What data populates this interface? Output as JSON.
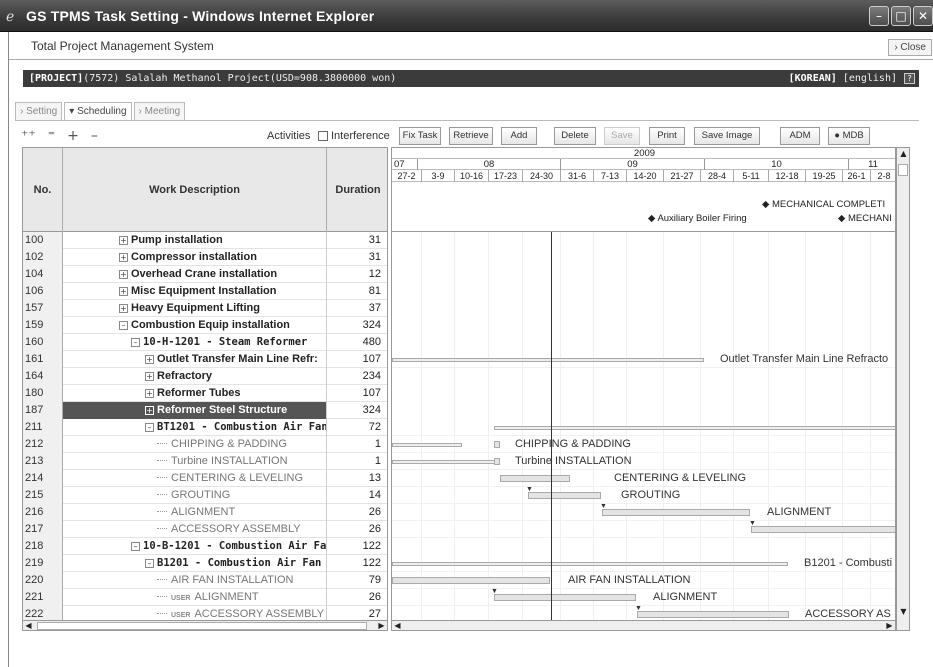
{
  "window": {
    "title": "GS TPMS Task Setting - Windows Internet Explorer",
    "system_title": "Total Project Management System",
    "close_label": "Close"
  },
  "project": {
    "tag": "[PROJECT]",
    "name": "(7572) Salalah Methanol Project(USD=908.3800000 won)",
    "lang_korean": "[KOREAN]",
    "lang_english": "[english]"
  },
  "tabs": [
    "Setting",
    "Scheduling",
    "Meeting"
  ],
  "toolbar": {
    "activities_label": "Activities",
    "interference_label": "Interference",
    "buttons": [
      "Fix Task",
      "Retrieve",
      "Add",
      "Delete",
      "Save",
      "Print",
      "Save Image",
      "ADM",
      "MDB"
    ]
  },
  "grid": {
    "columns": [
      "No.",
      "Work Description",
      "Duration"
    ],
    "rows": [
      {
        "no": "100",
        "desc": "Pump installation",
        "dur": "31"
      },
      {
        "no": "102",
        "desc": "Compressor installation",
        "dur": "31"
      },
      {
        "no": "104",
        "desc": "Overhead Crane installation",
        "dur": "12"
      },
      {
        "no": "106",
        "desc": "Misc Equipment Installation",
        "dur": "81"
      },
      {
        "no": "157",
        "desc": "Heavy Equipment Lifting",
        "dur": "37"
      },
      {
        "no": "159",
        "desc": "Combustion Equip installation",
        "dur": "324"
      },
      {
        "no": "160",
        "desc": "10-H-1201 - Steam Reformer",
        "dur": "480"
      },
      {
        "no": "161",
        "desc": "Outlet Transfer Main Line Refr:",
        "dur": "107"
      },
      {
        "no": "164",
        "desc": "Refractory",
        "dur": "234"
      },
      {
        "no": "180",
        "desc": "Reformer Tubes",
        "dur": "107"
      },
      {
        "no": "187",
        "desc": "Reformer Steel Structure",
        "dur": "324"
      },
      {
        "no": "211",
        "desc": "BT1201 - Combustion Air Fan",
        "dur": "72"
      },
      {
        "no": "212",
        "desc": "CHIPPING & PADDING",
        "dur": "1"
      },
      {
        "no": "213",
        "desc": "Turbine INSTALLATION",
        "dur": "1"
      },
      {
        "no": "214",
        "desc": "CENTERING & LEVELING",
        "dur": "13"
      },
      {
        "no": "215",
        "desc": "GROUTING",
        "dur": "14"
      },
      {
        "no": "216",
        "desc": "ALIGNMENT",
        "dur": "26"
      },
      {
        "no": "217",
        "desc": "ACCESSORY ASSEMBLY",
        "dur": "26"
      },
      {
        "no": "218",
        "desc": "10-B-1201 - Combustion Air Fa",
        "dur": "122"
      },
      {
        "no": "219",
        "desc": "B1201 - Combustion Air Fan",
        "dur": "122"
      },
      {
        "no": "220",
        "desc": "AIR FAN INSTALLATION",
        "dur": "79"
      },
      {
        "no": "221",
        "desc": "ALIGNMENT",
        "dur": "26"
      },
      {
        "no": "222",
        "desc": "ACCESSORY ASSEMBLY",
        "dur": "27"
      }
    ],
    "user_tag": "USER"
  },
  "timeline": {
    "year": "2009",
    "months": [
      "07",
      "08",
      "09",
      "10",
      "11"
    ],
    "weeks": [
      "27-2",
      "3-9",
      "10-16",
      "17-23",
      "24-30",
      "31-6",
      "7-13",
      "14-20",
      "21-27",
      "28-4",
      "5-11",
      "12-18",
      "19-25",
      "26-1",
      "2-8"
    ],
    "milestones": [
      "MECHANICAL COMPLETI",
      "Auxiliary Boiler Firing",
      "MECHANI"
    ],
    "bar_labels": {
      "r161": "Outlet Transfer Main Line Refracto",
      "r212": "CHIPPING & PADDING",
      "r213": "Turbine INSTALLATION",
      "r214": "CENTERING & LEVELING",
      "r215": "GROUTING",
      "r216": "ALIGNMENT",
      "r219": "B1201 - Combusti",
      "r220": "AIR FAN INSTALLATION",
      "r221": "ALIGNMENT",
      "r222": "ACCESSORY AS"
    }
  }
}
